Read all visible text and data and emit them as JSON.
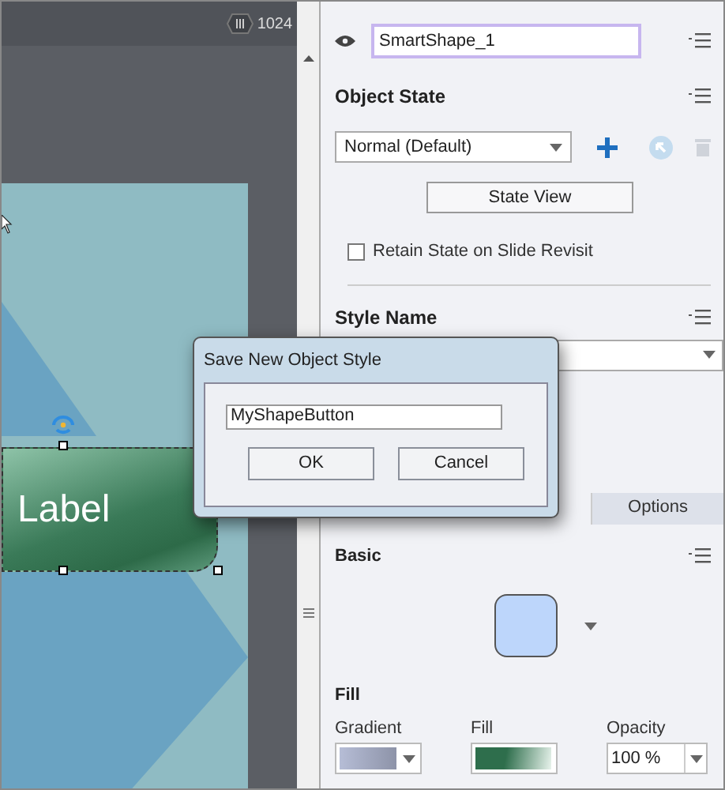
{
  "ruler": {
    "marker": "1024"
  },
  "canvas": {
    "shape_label": "Label"
  },
  "object_name": "SmartShape_1",
  "object_state": {
    "title": "Object State",
    "dropdown": "Normal (Default)",
    "state_view_button": "State View",
    "retain_checkbox": {
      "label": "Retain State on Slide Revisit",
      "checked": false
    }
  },
  "style_name": {
    "title": "Style Name"
  },
  "tabs": [
    {
      "label": "Options",
      "selected": false
    }
  ],
  "basic": {
    "title": "Basic"
  },
  "fill": {
    "title": "Fill",
    "controls": [
      {
        "label": "Gradient",
        "kind": "gradient"
      },
      {
        "label": "Fill",
        "kind": "color"
      },
      {
        "label": "Opacity",
        "kind": "value",
        "value": "100 %"
      }
    ]
  },
  "dialog": {
    "title": "Save New Object Style",
    "value": "MyShapeButton",
    "buttons": [
      "OK",
      "Cancel"
    ]
  }
}
